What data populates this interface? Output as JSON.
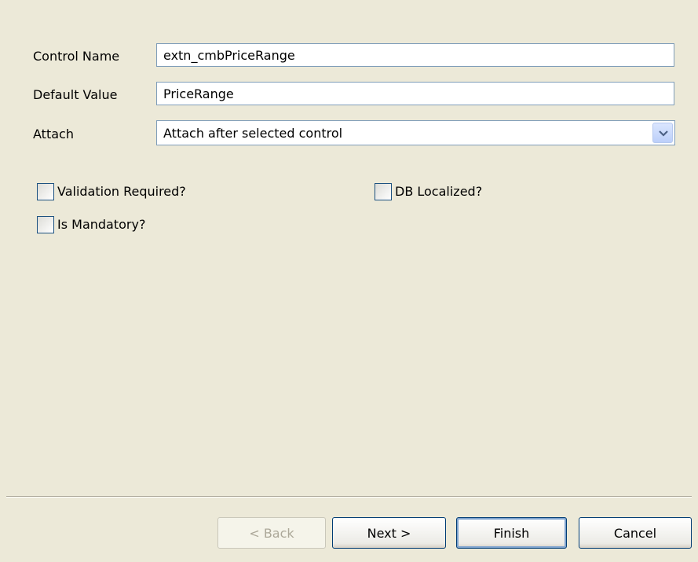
{
  "form": {
    "control_name": {
      "label": "Control Name",
      "value": "extn_cmbPriceRange"
    },
    "default_value": {
      "label": "Default Value",
      "value": "PriceRange"
    },
    "attach": {
      "label": "Attach",
      "selected": "Attach after selected control"
    }
  },
  "options": {
    "validation_required": {
      "label": "Validation Required?",
      "checked": false
    },
    "db_localized": {
      "label": "DB Localized?",
      "checked": false
    },
    "is_mandatory": {
      "label": "Is Mandatory?",
      "checked": false
    }
  },
  "buttons": {
    "back": "< Back",
    "next": "Next >",
    "finish": "Finish",
    "cancel": "Cancel"
  },
  "icons": {
    "dropdown": "chevron-down-icon"
  },
  "colors": {
    "background": "#ece9d8",
    "field_border": "#7f9db9",
    "button_border": "#003c74"
  }
}
